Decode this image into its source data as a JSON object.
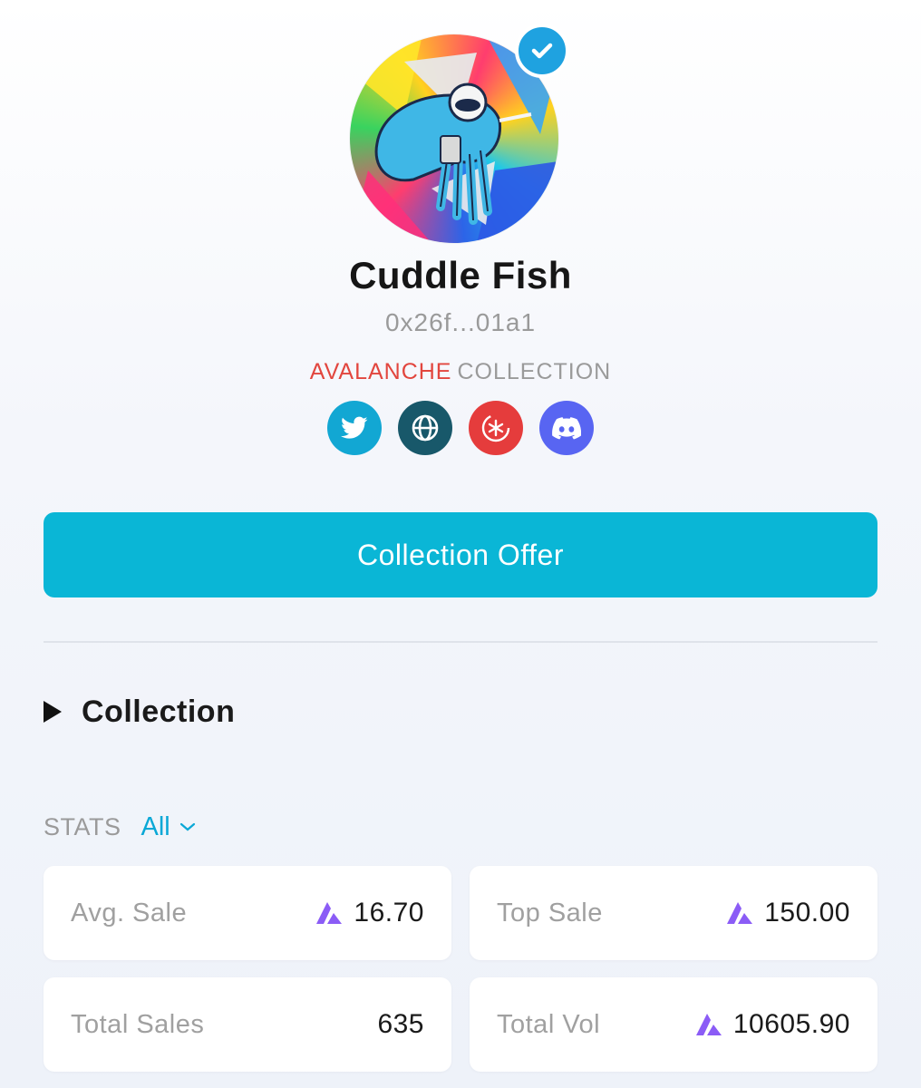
{
  "collection": {
    "name": "Cuddle Fish",
    "address": "0x26f...01a1",
    "chain": "AVALANCHE",
    "chain_suffix": "COLLECTION",
    "verified": true
  },
  "socials": [
    {
      "name": "twitter",
      "icon": "twitter-icon",
      "color": "#12a7d3"
    },
    {
      "name": "website",
      "icon": "globe-icon",
      "color": "#18586a"
    },
    {
      "name": "snowtrace",
      "icon": "snowflake-icon",
      "color": "#e53c3c"
    },
    {
      "name": "discord",
      "icon": "discord-icon",
      "color": "#5865f2"
    }
  ],
  "actions": {
    "offer_label": "Collection Offer"
  },
  "collection_section": {
    "label": "Collection"
  },
  "stats": {
    "label": "STATS",
    "filter": "All",
    "items": [
      {
        "key": "Avg. Sale",
        "value": "16.70",
        "currency_icon": "avax-icon"
      },
      {
        "key": "Top Sale",
        "value": "150.00",
        "currency_icon": "avax-icon"
      },
      {
        "key": "Total Sales",
        "value": "635"
      },
      {
        "key": "Total Vol",
        "value": "10605.90",
        "currency_icon": "avax-icon"
      }
    ]
  },
  "colors": {
    "accent": "#0ab6d6",
    "chain": "#e2463e",
    "verified": "#1fa2e0",
    "avax": "#8b5cf6"
  }
}
